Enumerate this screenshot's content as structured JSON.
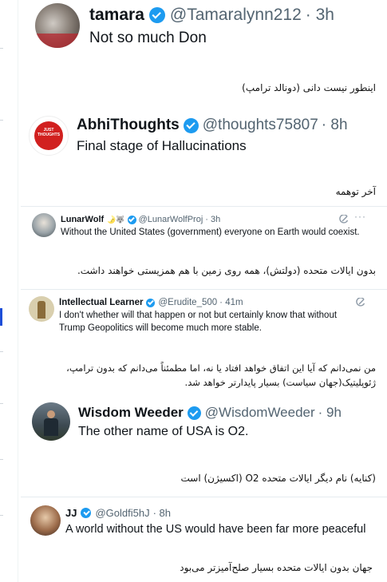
{
  "tweets": [
    {
      "name": "tamara",
      "handle": "@Tamaralynn212",
      "time": "· 3h",
      "text": "Not so much Don",
      "translation": "اینطور نیست دانی (دونالد ترامپ)"
    },
    {
      "name": "AbhiThoughts",
      "handle": "@thoughts75807",
      "time": "· 8h",
      "text": "Final stage of Hallucinations",
      "translation": "آخر توهمه",
      "avatar_label": "JUST THOUGHTS"
    },
    {
      "name": "LunarWolf",
      "name_emoji": "🌛🐺",
      "handle": "@LunarWolfProj",
      "time": "· 3h",
      "text": "Without the United States (government) everyone on Earth would coexist.",
      "translation": "بدون ایالات متحده (دولتش)، همه روی زمین با هم همزیستی خواهند داشت."
    },
    {
      "name": "Intellectual Learner",
      "handle": "@Erudite_500",
      "time": "· 41m",
      "text_lines": [
        "I don't whether will that happen or not but certainly know that without",
        "Trump Geopolitics will become much more stable."
      ],
      "translation_lines": [
        "من نمی‌دانم که آیا این اتفاق خواهد افتاد یا نه، اما مطمئناً می‌دانم که بدون ترامپ،",
        "ژئوپلیتیک(جهان سیاست)  بسیار پایدارتر خواهد شد."
      ]
    },
    {
      "name": "Wisdom Weeder",
      "handle": "@WisdomWeeder",
      "time": "· 9h",
      "text": "The other name of USA is O2.",
      "translation": "(کنایه) نام دیگر ایالات متحده O2 (اکسیژن) است"
    },
    {
      "name": "JJ",
      "handle": "@Goldfi5hJ",
      "time": "· 8h",
      "text": "A world without the US would have been far more peaceful",
      "translation": "جهان بدون ایالات متحده بسیار صلح‌آمیزتر می‌بود"
    }
  ],
  "icons": {
    "verified": "verified-badge-icon",
    "grok": "grok-icon",
    "more": "more-options-icon"
  },
  "colors": {
    "verified": "#1d9bf0",
    "handle": "#536471",
    "sidebar_accent": "#1d4ed8"
  }
}
